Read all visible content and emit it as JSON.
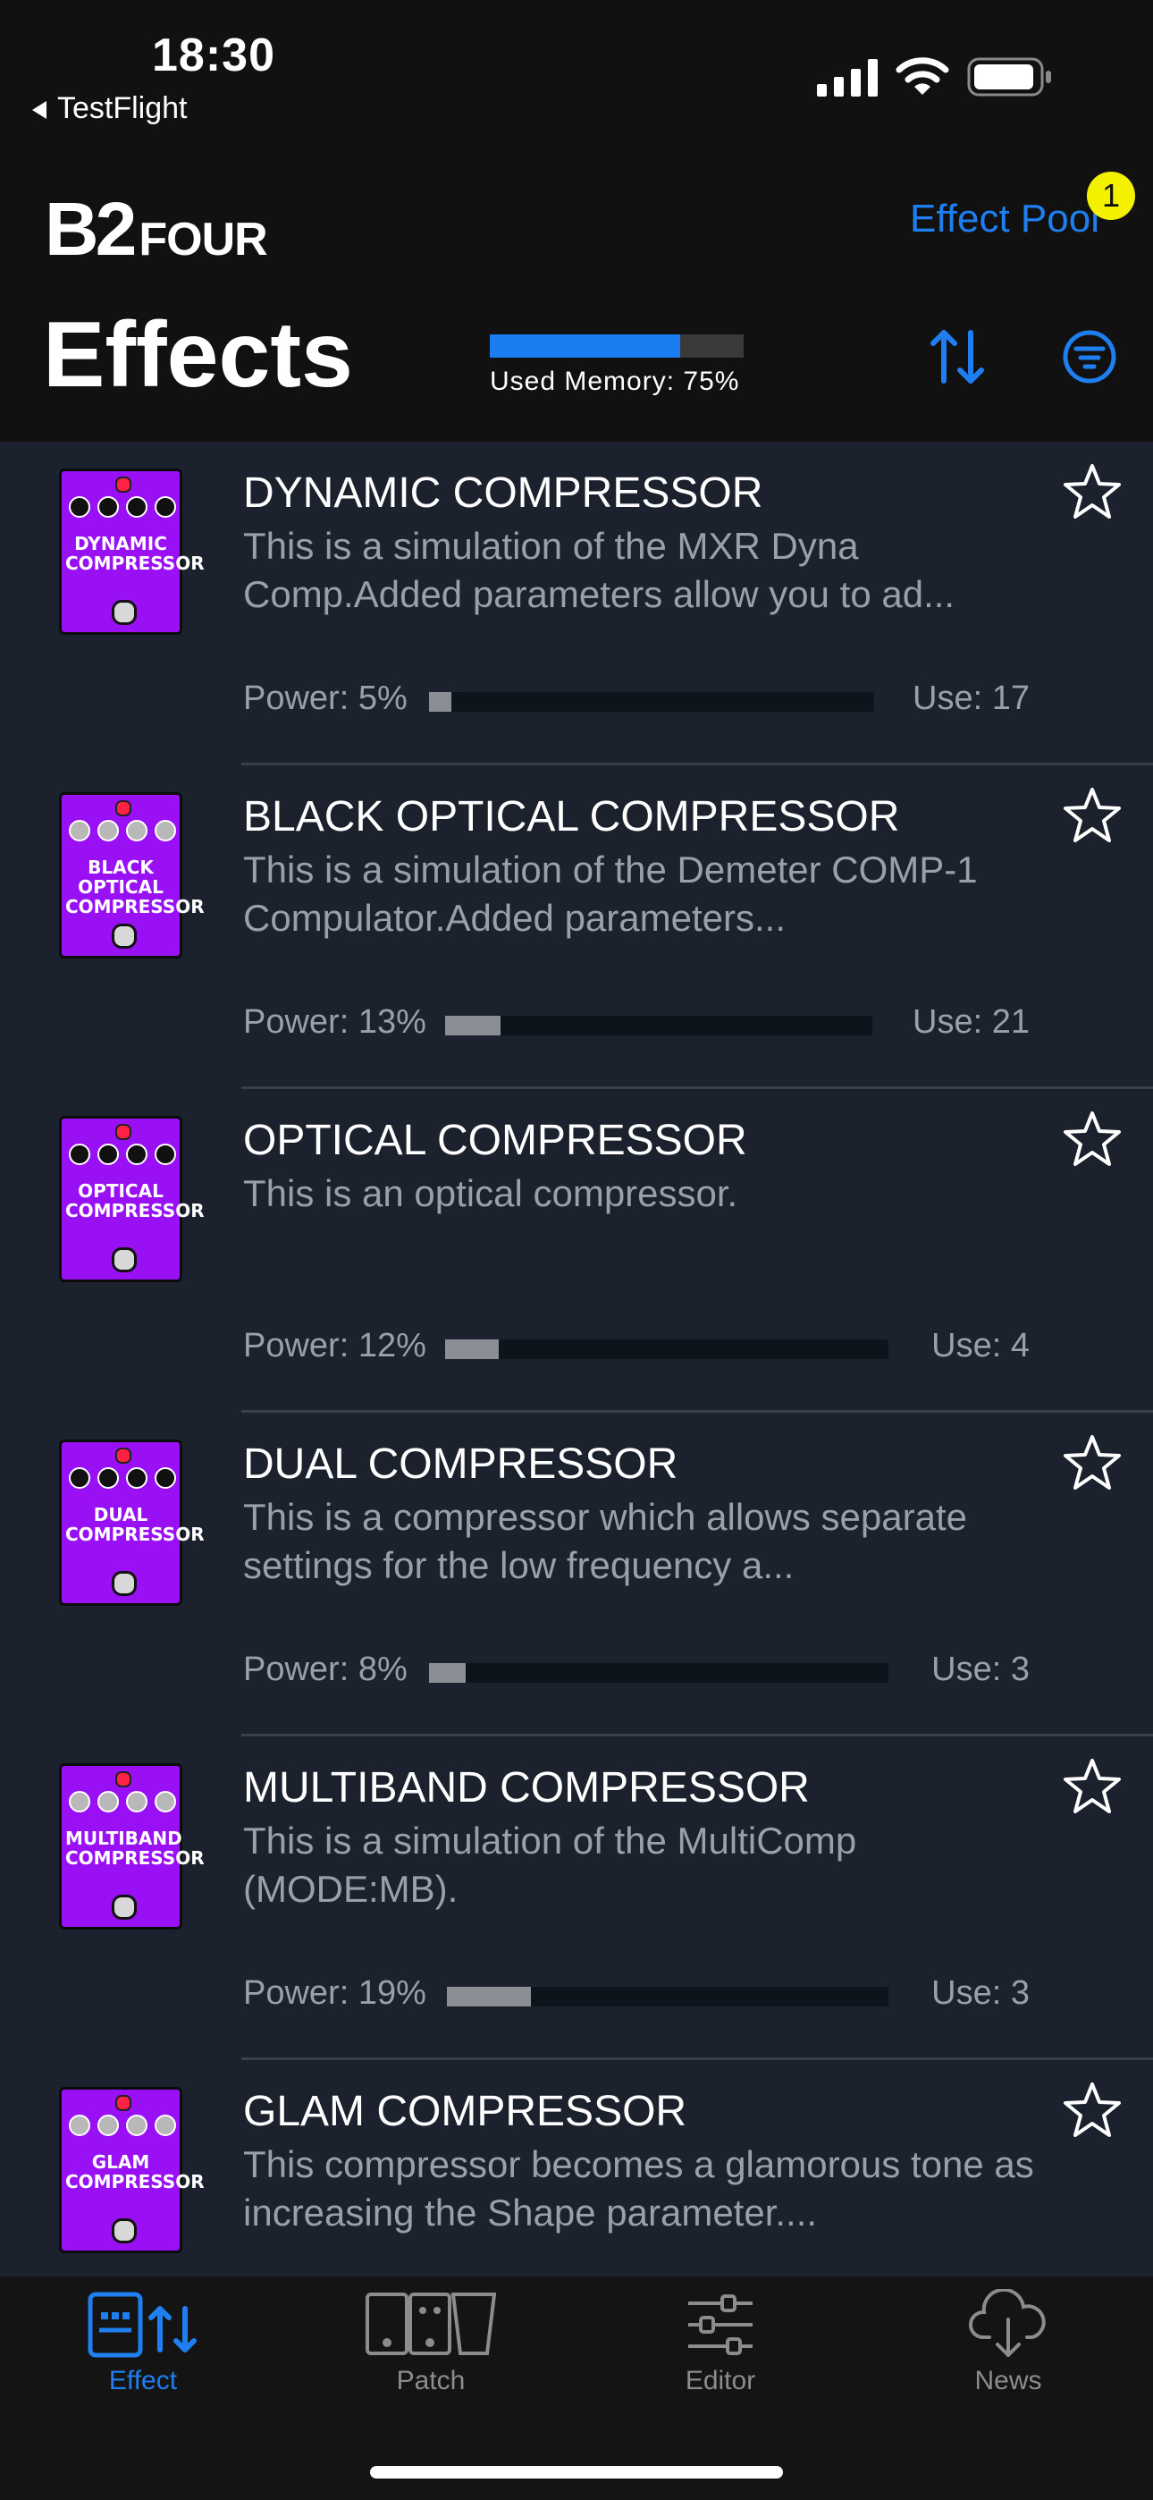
{
  "status_bar": {
    "time": "18:30",
    "back_app": "TestFlight"
  },
  "header": {
    "logo_big": "B2",
    "logo_small": "FOUR",
    "effect_pool_link": "Effect Pool",
    "badge_count": "1",
    "title": "Effects",
    "used_memory_label": "Used Memory: 75%",
    "used_memory_fraction": 0.75
  },
  "colors": {
    "accent": "#1f7ef0",
    "pedal": "#9a10f5",
    "badge": "#f4f100",
    "list_bg": "#1b222d"
  },
  "effects": [
    {
      "name": "DYNAMIC COMPRESSOR",
      "description": "This is a simulation of the MXR Dyna Comp.Added parameters allow you to ad...",
      "power_label": "Power: 5%",
      "power_fraction": 0.05,
      "use_label": "Use: 17",
      "pedal_label": "DYNAMIC\nCOMPRESSOR",
      "pedal_knob_style": "dark"
    },
    {
      "name": "BLACK OPTICAL COMPRESSOR",
      "description": "This is a simulation of the Demeter COMP-1 Compulator.Added parameters...",
      "power_label": "Power: 13%",
      "power_fraction": 0.13,
      "use_label": "Use: 21",
      "pedal_label": "BLACK\nOPTICAL\nCOMPRESSOR",
      "pedal_knob_style": "light"
    },
    {
      "name": "OPTICAL COMPRESSOR",
      "description": "This is an optical compressor.",
      "power_label": "Power: 12%",
      "power_fraction": 0.12,
      "use_label": "Use: 4",
      "pedal_label": "OPTICAL\nCOMPRESSOR",
      "pedal_knob_style": "dark"
    },
    {
      "name": "DUAL COMPRESSOR",
      "description": "This is a compressor which allows separate settings for the low frequency a...",
      "power_label": "Power: 8%",
      "power_fraction": 0.08,
      "use_label": "Use: 3",
      "pedal_label": "DUAL\nCOMPRESSOR",
      "pedal_knob_style": "dark"
    },
    {
      "name": "MULTIBAND COMPRESSOR",
      "description": "This is a simulation of the MultiComp (MODE:MB).",
      "power_label": "Power: 19%",
      "power_fraction": 0.19,
      "use_label": "Use: 3",
      "pedal_label": "MULTIBAND\nCOMPRESSOR",
      "pedal_knob_style": "light"
    },
    {
      "name": "GLAM COMPRESSOR",
      "description": "This compressor becomes a glamorous tone as increasing the Shape parameter....",
      "power_label": "",
      "power_fraction": null,
      "use_label": "",
      "pedal_label": "GLAM\nCOMPRESSOR",
      "pedal_knob_style": "light"
    }
  ],
  "tabs": [
    {
      "label": "Effect",
      "icon": "effect-tab-icon",
      "active": true
    },
    {
      "label": "Patch",
      "icon": "patch-tab-icon",
      "active": false
    },
    {
      "label": "Editor",
      "icon": "editor-tab-icon",
      "active": false
    },
    {
      "label": "News",
      "icon": "news-tab-icon",
      "active": false
    }
  ]
}
